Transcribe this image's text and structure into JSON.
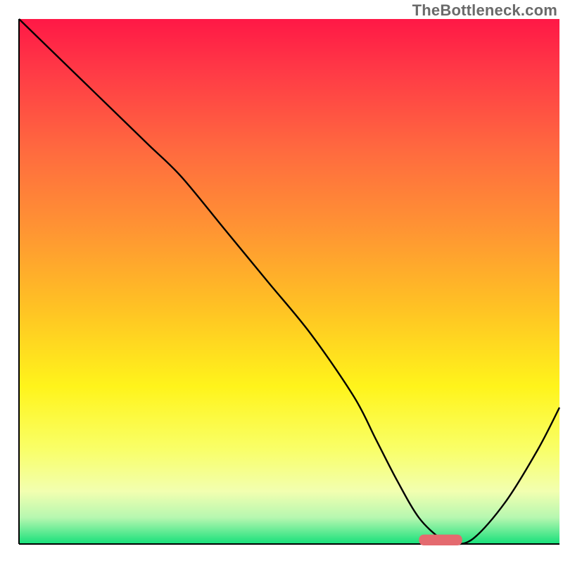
{
  "watermark": "TheBottleneck.com",
  "chart_data": {
    "type": "line",
    "title": "",
    "xlabel": "",
    "ylabel": "",
    "xlim": [
      0,
      100
    ],
    "ylim": [
      0,
      100
    ],
    "grid": false,
    "legend": false,
    "annotations": [],
    "background_gradient": {
      "stops": [
        {
          "offset": 0.0,
          "color": "#ff1846"
        },
        {
          "offset": 0.1,
          "color": "#ff3a46"
        },
        {
          "offset": 0.25,
          "color": "#ff6a3f"
        },
        {
          "offset": 0.4,
          "color": "#ff9433"
        },
        {
          "offset": 0.55,
          "color": "#ffc224"
        },
        {
          "offset": 0.7,
          "color": "#fff41b"
        },
        {
          "offset": 0.82,
          "color": "#f9ff68"
        },
        {
          "offset": 0.9,
          "color": "#f2ffb0"
        },
        {
          "offset": 0.95,
          "color": "#b6f7b0"
        },
        {
          "offset": 1.0,
          "color": "#16e07a"
        }
      ]
    },
    "series": [
      {
        "name": "bottleneck-curve",
        "color": "#000000",
        "stroke_width": 2.4,
        "x": [
          0,
          4,
          10,
          18,
          24,
          30,
          38,
          46,
          54,
          62,
          66,
          70,
          74,
          78,
          80,
          84,
          90,
          96,
          100
        ],
        "y": [
          100,
          96,
          90,
          82,
          76,
          70,
          60,
          50,
          40,
          28,
          20,
          12,
          5,
          1,
          0,
          1,
          8,
          18,
          26
        ]
      }
    ],
    "marker": {
      "name": "optimal-range",
      "color": "#e46a6f",
      "shape": "capsule",
      "x_start": 74,
      "x_end": 82,
      "y": 0,
      "height": 1.8
    }
  }
}
